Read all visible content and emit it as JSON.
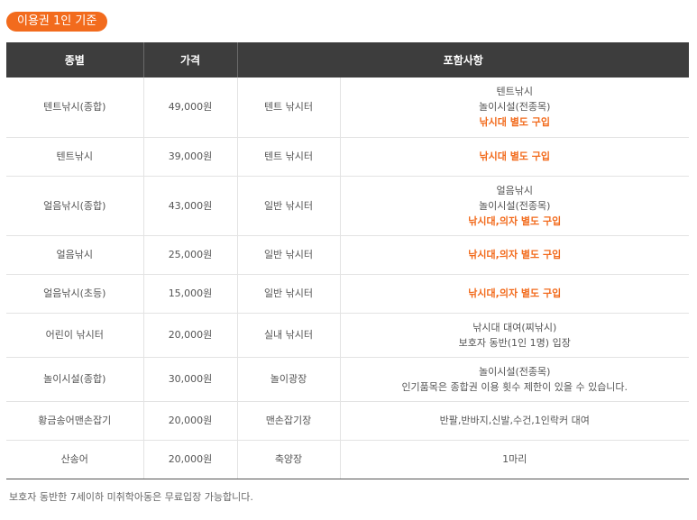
{
  "badge": "이용권 1인 기준",
  "headers": [
    "종별",
    "가격",
    "",
    "포함사항"
  ],
  "rows": [
    {
      "type": "텐트낚시(종합)",
      "price": "49,000원",
      "place": "텐트 낚시터",
      "lines": [
        {
          "text": "텐트낚시",
          "highlight": false
        },
        {
          "text": "놀이시설(전종목)",
          "highlight": false
        },
        {
          "text": "낚시대 별도 구입",
          "highlight": true
        }
      ]
    },
    {
      "type": "텐트낚시",
      "price": "39,000원",
      "place": "텐트 낚시터",
      "lines": [
        {
          "text": "낚시대 별도 구입",
          "highlight": true
        }
      ]
    },
    {
      "type": "얼음낚시(종합)",
      "price": "43,000원",
      "place": "일반 낚시터",
      "lines": [
        {
          "text": "얼음낚시",
          "highlight": false
        },
        {
          "text": "놀이시설(전종목)",
          "highlight": false
        },
        {
          "text": "낚시대,의자 별도 구입",
          "highlight": true
        }
      ]
    },
    {
      "type": "얼음낚시",
      "price": "25,000원",
      "place": "일반 낚시터",
      "lines": [
        {
          "text": "낚시대,의자 별도 구입",
          "highlight": true
        }
      ]
    },
    {
      "type": "얼음낚시(초등)",
      "price": "15,000원",
      "place": "일반 낚시터",
      "lines": [
        {
          "text": "낚시대,의자 별도 구입",
          "highlight": true
        }
      ]
    },
    {
      "type": "어린이 낚시터",
      "price": "20,000원",
      "place": "실내 낚시터",
      "lines": [
        {
          "text": "낚시대 대여(찌낚시)",
          "highlight": false
        },
        {
          "text": "보호자 동반(1인 1명) 입장",
          "highlight": false
        }
      ]
    },
    {
      "type": "놀이시설(종합)",
      "price": "30,000원",
      "place": "놀이광장",
      "lines": [
        {
          "text": "놀이시설(전종목)",
          "highlight": false
        },
        {
          "text": "인기품목은 종합권 이용 횟수 제한이 있을 수 있습니다.",
          "highlight": false
        }
      ]
    },
    {
      "type": "황금송어맨손잡기",
      "price": "20,000원",
      "place": "맨손잡기장",
      "lines": [
        {
          "text": "반팔,반바지,신발,수건,1인락커 대여",
          "highlight": false
        }
      ]
    },
    {
      "type": "산송어",
      "price": "20,000원",
      "place": "축양장",
      "lines": [
        {
          "text": "1마리",
          "highlight": false
        }
      ]
    }
  ],
  "note": "보호자 동반한 7세이하 미취학아동은 무료입장 가능합니다."
}
